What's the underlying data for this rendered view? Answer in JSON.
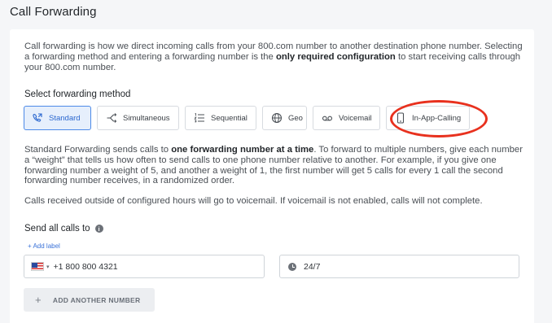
{
  "page": {
    "title": "Call Forwarding"
  },
  "intro": {
    "part1": "Call forwarding is how we direct incoming calls from your 800.com number to another destination phone number. Selecting a forwarding method and entering a forwarding number is the ",
    "bold": "only required configuration",
    "part2": " to start receiving calls through your 800.com number."
  },
  "methods": {
    "label": "Select forwarding method",
    "items": [
      {
        "label": "Standard",
        "icon": "phone-forward-icon",
        "active": true
      },
      {
        "label": "Simultaneous",
        "icon": "branch-icon"
      },
      {
        "label": "Sequential",
        "icon": "ordered-list-icon"
      },
      {
        "label": "Geo",
        "icon": "globe-icon"
      },
      {
        "label": "Voicemail",
        "icon": "voicemail-icon"
      },
      {
        "label": "In-App-Calling",
        "icon": "mobile-phone-icon",
        "highlighted": true
      }
    ],
    "active_color": "#2b67cf",
    "highlight_color": "#e8311e"
  },
  "description": {
    "part1": "Standard Forwarding sends calls to ",
    "bold": "one forwarding number at a time",
    "part2": ". To forward to multiple numbers, give each number a “weight” that tells us how often to send calls to one phone number relative to another. For example, if you give one forwarding number a weight of 5, and another a weight of 1, the first number will get 5 calls for every 1 call the second forwarding number receives, in a randomized order.",
    "note": "Calls received outside of configured hours will go to voicemail. If voicemail is not enabled, calls will not complete."
  },
  "send_all": {
    "label": "Send all calls to",
    "info_glyph": "i",
    "add_label": "+ Add label",
    "phone_number": "+1 800 800 4321",
    "country_caret": "▾",
    "hours": "24/7",
    "add_number_plus": "+",
    "add_number_button": "ADD ANOTHER NUMBER"
  }
}
